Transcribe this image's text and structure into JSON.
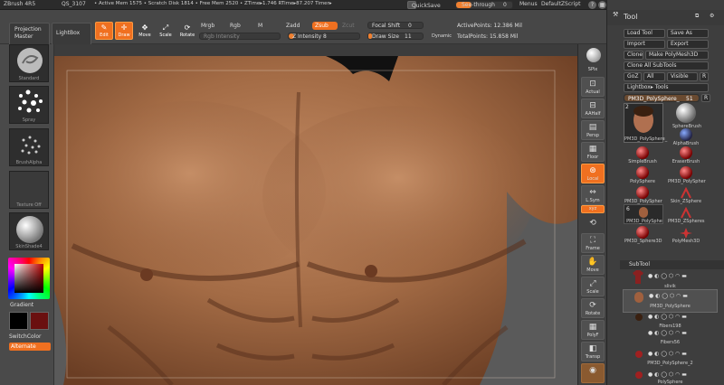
{
  "titlebar": {
    "app": "ZBrush 4R5",
    "doc": "QS_3107",
    "mem": "• Active Mem 1575 • Scratch Disk 1814 • Free Mem 2520 • ZTime▸1.746 RTime▸87.207 Timer▸",
    "quicksave": "QuickSave",
    "seethrough": "See-through",
    "seethrough_value": "0",
    "menus": "Menus",
    "script": "DefaultZScript"
  },
  "shelf": {
    "projection": [
      "Projection",
      "Master"
    ],
    "lightbox": "LightBox",
    "modes": [
      {
        "label": "Edit",
        "icon": "✎"
      },
      {
        "label": "Draw",
        "icon": "✛"
      },
      {
        "label": "Move",
        "icon": "✥"
      },
      {
        "label": "Scale",
        "icon": "⤢"
      },
      {
        "label": "Rotate",
        "icon": "⟳"
      }
    ],
    "mrgb": "Mrgb",
    "rgb": "Rgb",
    "m": "M",
    "rgb_intensity": "Rgb Intensity",
    "zadd": "Zadd",
    "zsub": "Zsub",
    "zcut": "Zcut",
    "z_intensity": "Z Intensity 8",
    "focal_shift": "Focal Shift",
    "focal_value": "0",
    "draw_size": "Draw Size",
    "draw_value": "11",
    "dynamic": "Dynamic",
    "active_points": "ActivePoints: 12.386 Mil",
    "total_points": "TotalPoints: 15.858 Mil"
  },
  "left_tray": {
    "brush": "Standard",
    "stroke": "Spray",
    "alpha": "BrushAlpha",
    "texture": "Texture Off",
    "material": "SkinShade4",
    "gradient": "Gradient",
    "switch_color": "SwitchColor",
    "alternate": "Alternate"
  },
  "right_tray": {
    "buttons": [
      "SPix",
      "Actual",
      "AAHalf",
      "Persp",
      "Floor",
      "Local",
      "L.Sym",
      "Frame",
      "Move",
      "Scale",
      "Rotate",
      "PolyF",
      "Transp"
    ],
    "xyz": "xyz",
    "spix_value": "3"
  },
  "palette": {
    "title": "Tool",
    "load_tool": "Load Tool",
    "save_as": "Save As",
    "import": "Import",
    "export": "Export",
    "clone": "Clone",
    "make_polymesh": "Make PolyMesh3D",
    "clone_all": "Clone All SubTools",
    "goz": "GoZ",
    "all": "All",
    "visible": "Visible",
    "r": "R",
    "lightbox_tools": "Lightbox▸ Tools",
    "current_tool": "PM3D_PolySphere_",
    "current_value": "51",
    "tools": [
      "PM3D_PolySphere_",
      "SphereBrush",
      "AlphaBrush",
      "SimpleBrush",
      "EraserBrush",
      "PolySphere",
      "PM3D_PolySpher",
      "PM3D_PolySpher",
      "Skin_ZSphere",
      "PM3D_PolySphe",
      "PM3D_ZSpheres",
      "PM3D_Sphere3D",
      "PolyMesh3D"
    ],
    "tool_badges": [
      "2",
      "6"
    ],
    "subtool_header": "SubTool",
    "subtools": [
      "slivik",
      "PM3D_PolySphere",
      "Fibers198",
      "Fibers56",
      "PM3D_PolySphere_2",
      "PolySphere"
    ]
  }
}
